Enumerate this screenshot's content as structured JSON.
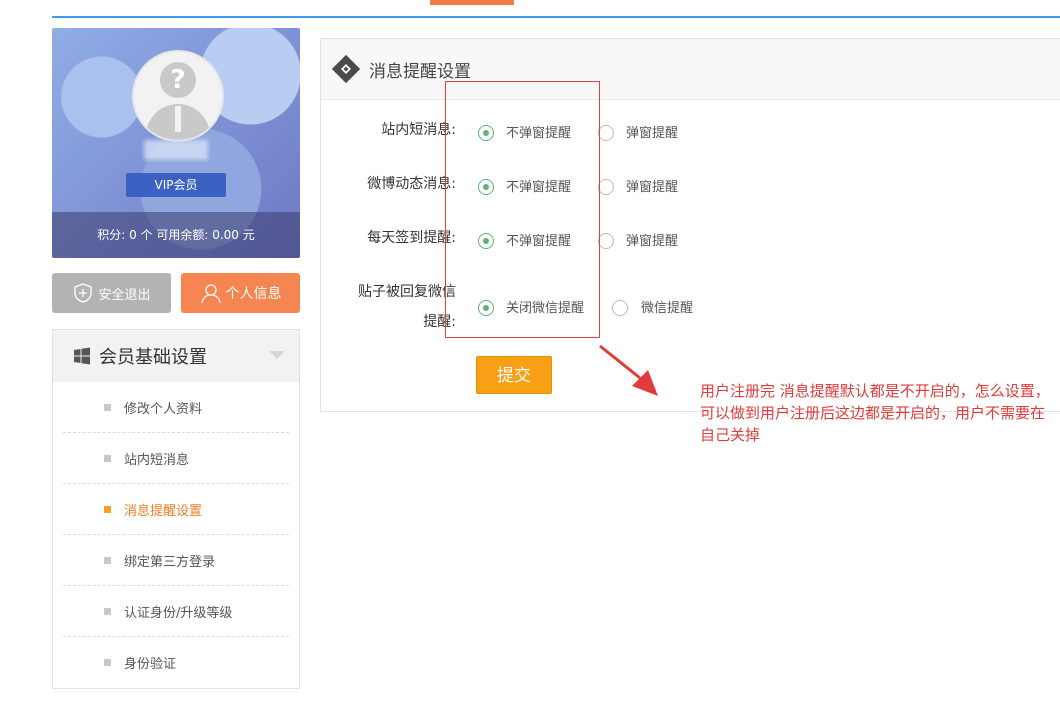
{
  "profile": {
    "vip_label": "VIP会员",
    "points_line": "积分: 0 个   可用余额:  0.00  元"
  },
  "buttons": {
    "logout": "安全退出",
    "profile": "个人信息"
  },
  "menu": {
    "title": "会员基础设置",
    "items": [
      {
        "label": "修改个人资料"
      },
      {
        "label": "站内短消息"
      },
      {
        "label": "消息提醒设置"
      },
      {
        "label": "绑定第三方登录"
      },
      {
        "label": "认证身份/升级等级"
      },
      {
        "label": "身份验证"
      }
    ]
  },
  "panel": {
    "title": "消息提醒设置",
    "rows": [
      {
        "label": "站内短消息:",
        "option_off": "不弹窗提醒",
        "option_on": "弹窗提醒",
        "selected": "off"
      },
      {
        "label": "微博动态消息:",
        "option_off": "不弹窗提醒",
        "option_on": "弹窗提醒",
        "selected": "off"
      },
      {
        "label": "每天签到提醒:",
        "option_off": "不弹窗提醒",
        "option_on": "弹窗提醒",
        "selected": "off"
      },
      {
        "label_line1": "贴子被回复微信",
        "label_line2": "提醒:",
        "option_off": "关闭微信提醒",
        "option_on": "微信提醒",
        "selected": "off"
      }
    ],
    "submit": "提交"
  },
  "annotation": {
    "note": "用户注册完 消息提醒默认都是不开启的，怎么设置，可以做到用户注册后这边都是开启的，用户不需要在自己关掉"
  },
  "colors": {
    "accent_blue": "#3e9ce6",
    "accent_orange": "#f58652",
    "submit_orange": "#f7a015",
    "radio_green": "#5db378",
    "annotation_red": "#e23b3b"
  }
}
